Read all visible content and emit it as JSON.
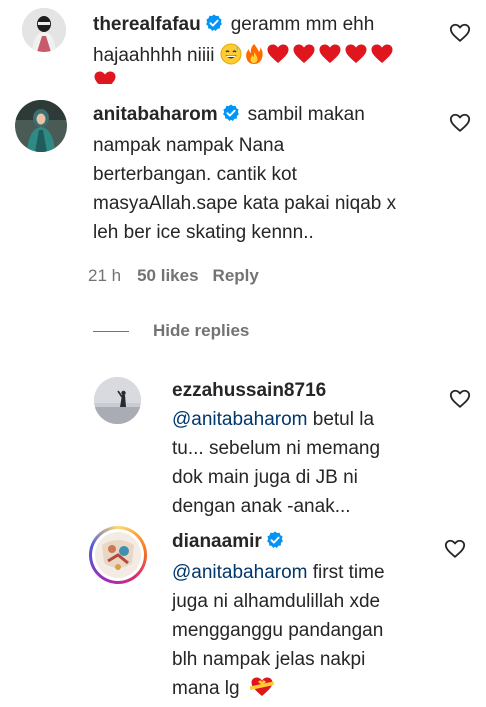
{
  "comments": [
    {
      "username": "therealfafau",
      "line1": "geramm mm ehh",
      "line2": "hajaahhhh niiii",
      "emojis": [
        "grinning-sweat",
        "fire",
        "heart",
        "heart",
        "heart",
        "heart",
        "heart",
        "heart"
      ]
    },
    {
      "username": "anitabaharom",
      "line1": "sambil makan",
      "line2": "nampak nampak Nana",
      "line3": "berterbangan. cantik kot",
      "line4": "masyaAllah.sape kata pakai niqab x",
      "line5": "leh ber ice skating kennn..",
      "time": "21 h",
      "likes": "50 likes",
      "reply": "Reply"
    }
  ],
  "hide_replies": "Hide replies",
  "replies": [
    {
      "username": "ezzahussain8716",
      "mention": "@anitabaharom",
      "line1": " betul la",
      "line2": "tu... sebelum ni memang",
      "line3": "dok main juga di JB ni",
      "line4": "dengan anak -anak..."
    },
    {
      "username": "dianaamir",
      "mention": "@anitabaharom",
      "line1": " first time",
      "line2": "juga ni alhamdulillah xde",
      "line3": "mengganggu pandangan",
      "line4": "blh nampak jelas nakpi",
      "line5": "mana lg"
    }
  ],
  "colors": {
    "text": "#262626",
    "muted": "#737373",
    "mention": "#00376b",
    "verified": "#0095f6",
    "heart_emoji": "#e0161e"
  }
}
